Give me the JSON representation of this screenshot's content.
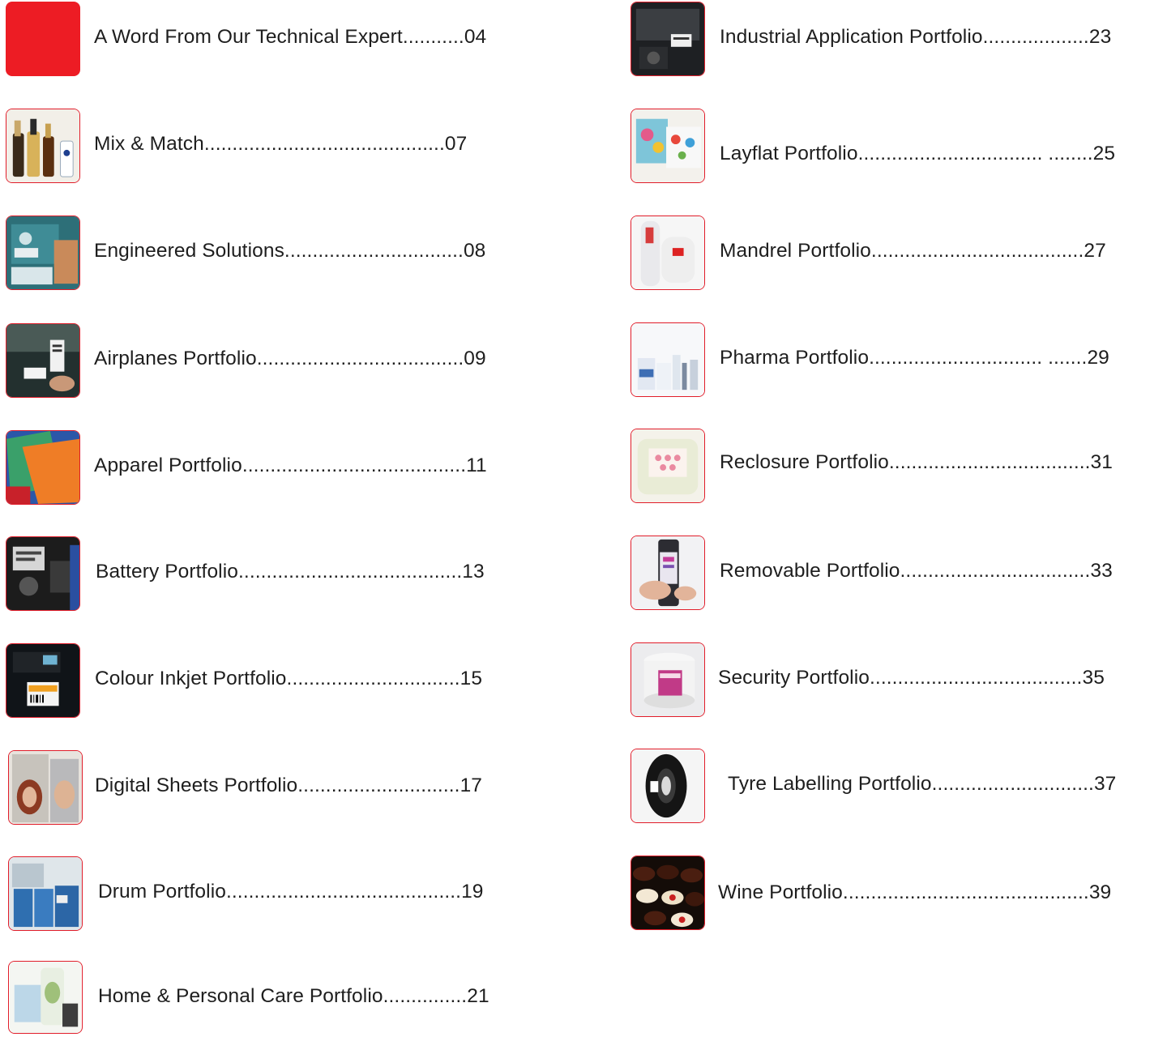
{
  "toc": {
    "left": [
      {
        "title": "A Word From Our Technical Expert",
        "leader": "...........",
        "page": "04",
        "image": "red-square"
      },
      {
        "title": "Mix & Match",
        "leader": "...........................................",
        "page": "07",
        "image": "bottles-photo"
      },
      {
        "title": "Engineered Solutions",
        "leader": "................................",
        "page": "08",
        "image": "engineering-photo"
      },
      {
        "title": "Airplanes Portfolio",
        "leader": ".....................................",
        "page": "09",
        "image": "airplane-label-photo"
      },
      {
        "title": "Apparel Portfolio",
        "leader": "........................................",
        "page": "11",
        "image": "apparel-fabric-photo"
      },
      {
        "title": "Battery Portfolio",
        "leader": "........................................",
        "page": "13",
        "image": "battery-photo"
      },
      {
        "title": "Colour Inkjet Portfolio",
        "leader": "...............................",
        "page": "15",
        "image": "inkjet-label-photo"
      },
      {
        "title": "Digital Sheets Portfolio",
        "leader": ".............................",
        "page": "17",
        "image": "cosmetics-box-photo"
      },
      {
        "title": "Drum Portfolio",
        "leader": "..........................................",
        "page": "19",
        "image": "drums-photo"
      },
      {
        "title": "Home & Personal Care Portfolio",
        "leader": "...............",
        "page": "21",
        "image": "personal-care-photo"
      }
    ],
    "right": [
      {
        "title": "Industrial Application Portfolio",
        "leader": "...................",
        "page": "23",
        "image": "industrial-photo"
      },
      {
        "title": "Layflat Portfolio",
        "leader": "................................. ........",
        "page": "25",
        "image": "layflat-photo"
      },
      {
        "title": "Mandrel Portfolio",
        "leader": "......................................",
        "page": "27",
        "image": "mandrel-tubes-photo"
      },
      {
        "title": "Pharma Portfolio",
        "leader": "............................... .......",
        "page": "29",
        "image": "pharma-bottles-photo"
      },
      {
        "title": "Reclosure Portfolio",
        "leader": "....................................",
        "page": "31",
        "image": "wipes-pack-photo"
      },
      {
        "title": "Removable Portfolio",
        "leader": "..................................",
        "page": "33",
        "image": "removable-label-photo"
      },
      {
        "title": "Security Portfolio",
        "leader": "......................................",
        "page": "35",
        "image": "security-jar-photo"
      },
      {
        "title": "Tyre Labelling Portfolio",
        "leader": ".............................",
        "page": "37",
        "image": "tyre-photo"
      },
      {
        "title": "Wine Portfolio",
        "leader": "............................................",
        "page": "39",
        "image": "wine-bottles-photo"
      }
    ]
  },
  "colors": {
    "accent": "#ed1c24",
    "text": "#1e1e1e"
  }
}
